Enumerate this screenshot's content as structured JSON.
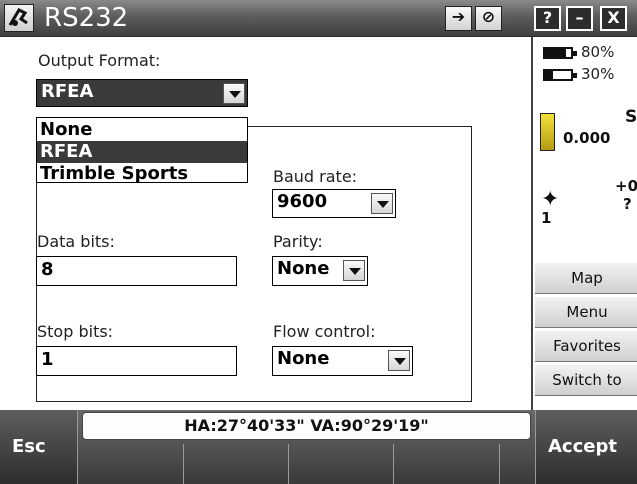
{
  "window": {
    "title": "RS232"
  },
  "titlebar": {
    "icon_button_1": "➔",
    "icon_button_2": "⊘",
    "help": "?",
    "minimize": "–",
    "close": "X"
  },
  "form": {
    "output_format_label": "Output Format:",
    "output_format_value": "RFEA",
    "output_format_options": [
      "None",
      "RFEA",
      "Trimble Sports"
    ],
    "baud_rate_label": "Baud rate:",
    "baud_rate_value": "9600",
    "data_bits_label": "Data bits:",
    "data_bits_value": "8",
    "parity_label": "Parity:",
    "parity_value": "None",
    "stop_bits_label": "Stop bits:",
    "stop_bits_value": "1",
    "flow_control_label": "Flow control:",
    "flow_control_value": "None"
  },
  "side": {
    "battery_1": "80%",
    "battery_1_level": 0.8,
    "battery_2": "30%",
    "battery_2_level": 0.3,
    "instrument_label": "S",
    "instrument_value": "0.000",
    "gnss_value_top": "+0",
    "gnss_value_bottom": "?",
    "gnss_count": "1",
    "buttons": [
      "Map",
      "Menu",
      "Favorites",
      "Switch to"
    ]
  },
  "bottom": {
    "esc": "Esc",
    "status": "HA:27°40'33\"  VA:90°29'19\"",
    "accept": "Accept"
  }
}
